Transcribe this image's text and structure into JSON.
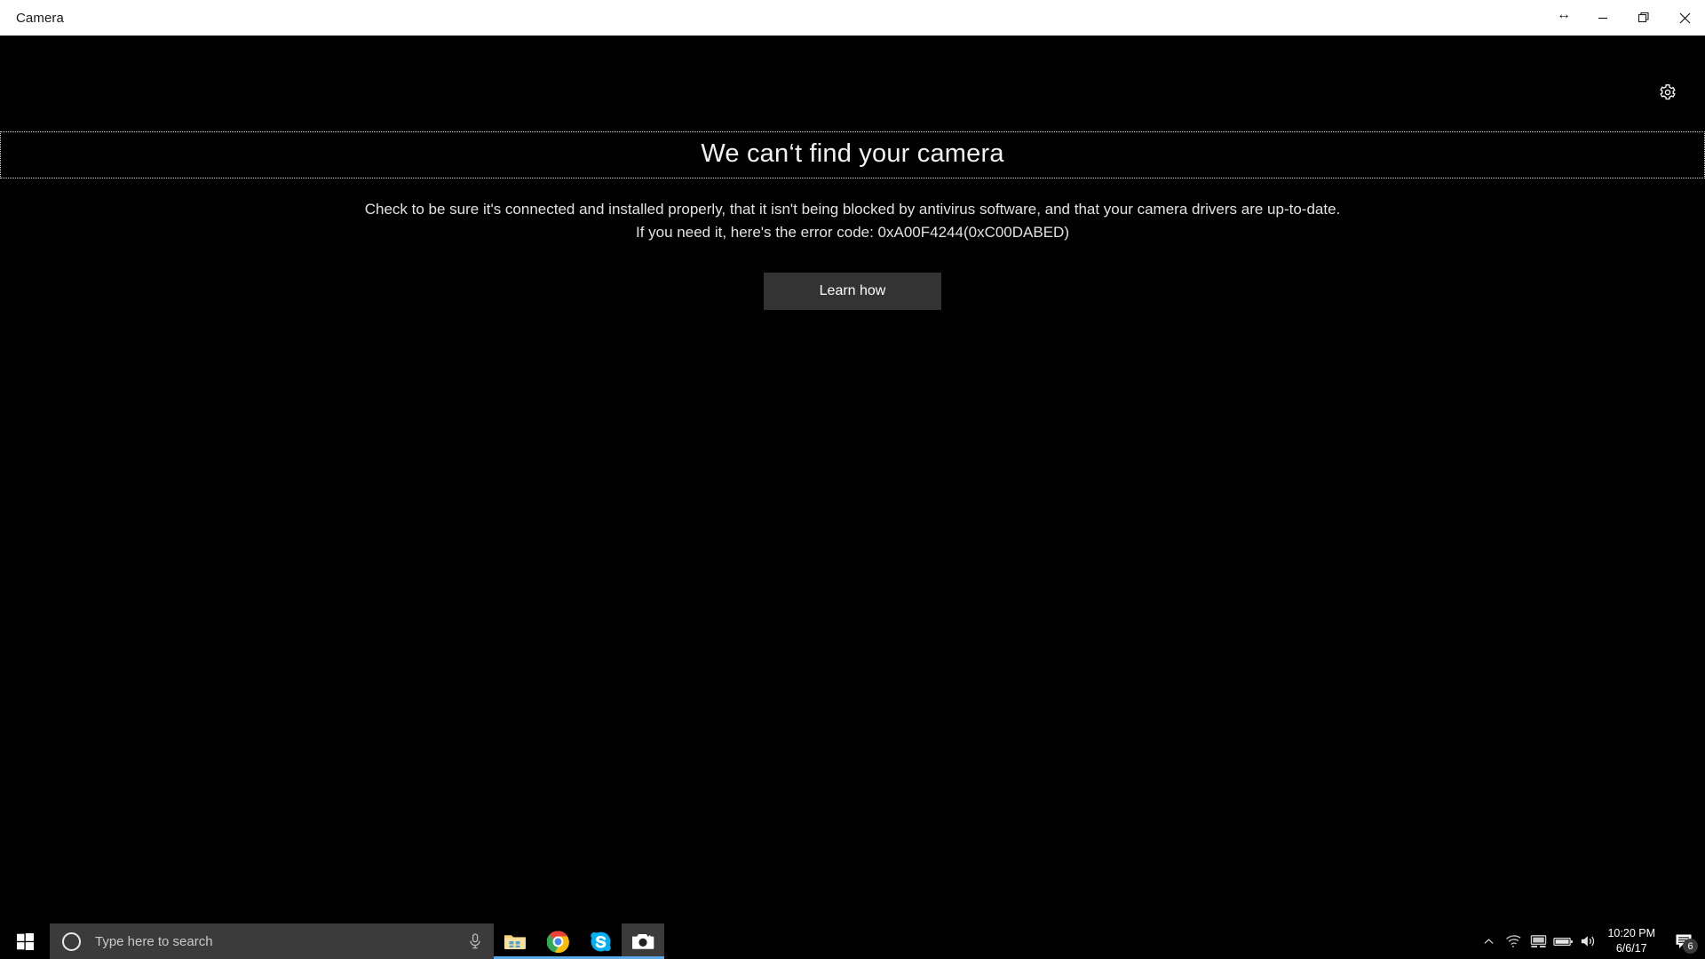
{
  "window": {
    "title": "Camera",
    "controls": {
      "resize": "resize-window",
      "minimize": "minimize",
      "restore": "restore",
      "close": "close"
    }
  },
  "viewport": {
    "settings_label": "Settings",
    "background_color": "#000000"
  },
  "error": {
    "heading": "We can‘t find your camera",
    "body_line1": "Check to be sure it's connected and installed properly, that it isn't being blocked by antivirus software, and that your camera drivers are up-to-date.",
    "body_line2": "If you need it, here's the error code: 0xA00F4244(0xC00DABED)",
    "error_code": "0xA00F4244(0xC00DABED)",
    "button_label": "Learn how",
    "button_color": "#333333"
  },
  "taskbar": {
    "start_label": "Start",
    "search": {
      "placeholder": "Type here to search",
      "value": "",
      "cortana_label": "Cortana",
      "mic_label": "Microphone"
    },
    "apps": [
      {
        "name": "file-explorer",
        "label": "File Explorer",
        "active": false,
        "running": true
      },
      {
        "name": "google-chrome",
        "label": "Google Chrome",
        "active": false,
        "running": true
      },
      {
        "name": "skype",
        "label": "Skype",
        "active": false,
        "running": true
      },
      {
        "name": "camera",
        "label": "Camera",
        "active": true,
        "running": true
      }
    ],
    "tray": {
      "icons": [
        "show-hidden-icons",
        "wifi",
        "display",
        "battery",
        "volume"
      ],
      "time": "10:20 PM",
      "date": "6/6/17",
      "notification_count": "6",
      "accent_color": "#5ba9e8"
    }
  }
}
